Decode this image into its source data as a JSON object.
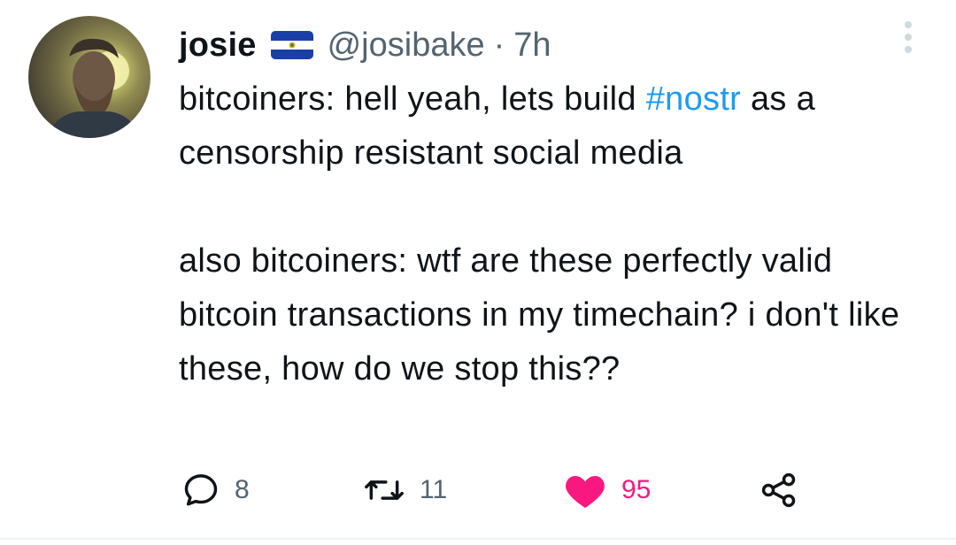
{
  "tweet": {
    "author": {
      "display_name": "josie",
      "handle": "@josibake",
      "flag_icon": "el-salvador-flag-icon"
    },
    "separator": "·",
    "timestamp": "7h",
    "text": {
      "line1_before": "bitcoiners: hell yeah, lets build ",
      "hashtag": "#nostr",
      "line1_after": " as a censorship resistant social media",
      "paragraph2": "also bitcoiners: wtf are these perfectly valid bitcoin transactions in my timechain? i don't like these, how do we stop this??"
    },
    "actions": {
      "reply_count": "8",
      "retweet_count": "11",
      "like_count": "95",
      "liked": true
    }
  },
  "colors": {
    "text": "#0f1419",
    "secondary": "#536471",
    "link": "#1d9bf0",
    "like": "#f91880",
    "flag_blue": "#1a3fa6"
  }
}
